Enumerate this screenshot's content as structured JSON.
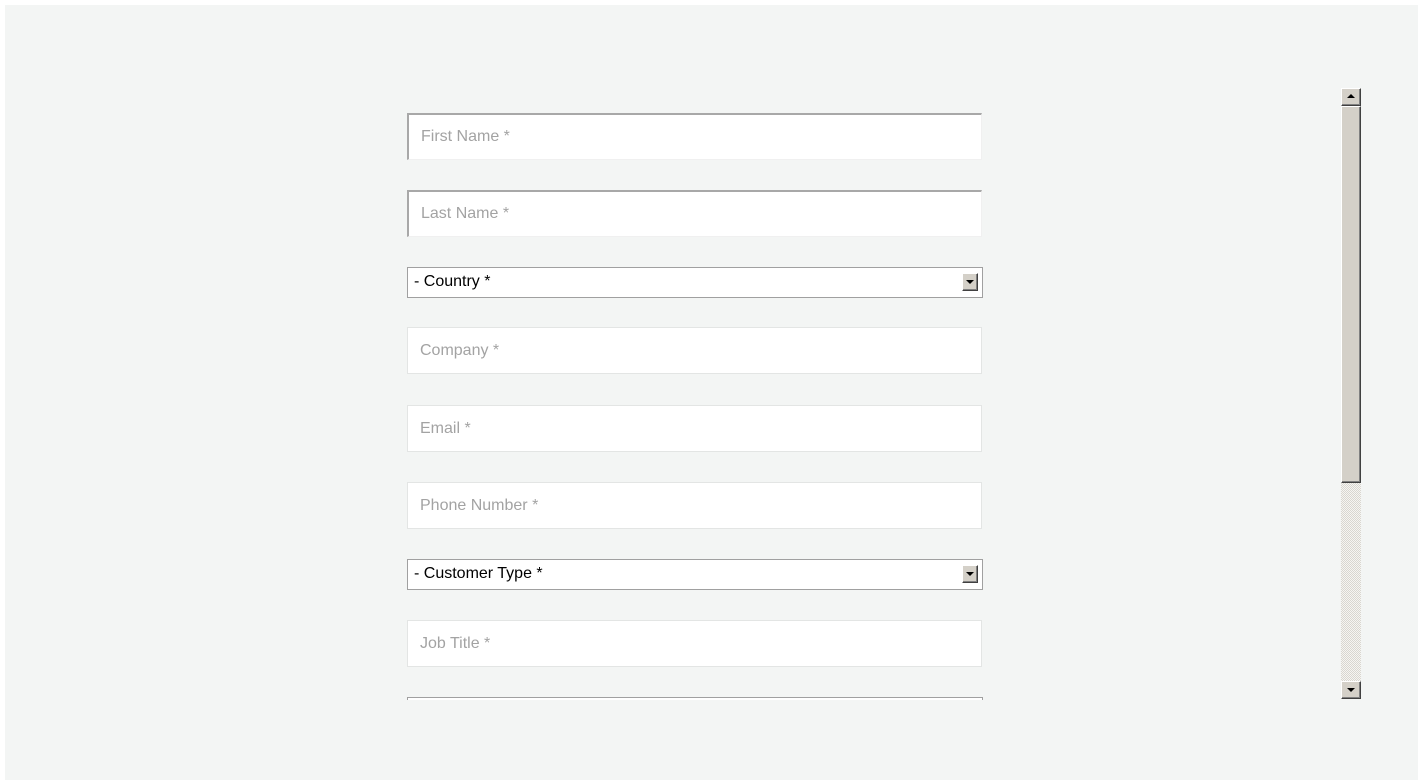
{
  "form": {
    "first_name": {
      "placeholder": "First Name *",
      "value": ""
    },
    "last_name": {
      "placeholder": "Last Name *",
      "value": ""
    },
    "country": {
      "selected": "- Country *"
    },
    "company": {
      "placeholder": "Company *",
      "value": ""
    },
    "email": {
      "placeholder": "Email *",
      "value": ""
    },
    "phone": {
      "placeholder": "Phone Number *",
      "value": ""
    },
    "customer_type": {
      "selected": "- Customer Type *"
    },
    "job_title": {
      "placeholder": "Job Title *",
      "value": ""
    },
    "next_select": {
      "selected": ""
    }
  },
  "icons": {
    "dropdown": "chevron-down-icon",
    "scroll_up": "scroll-up-arrow-icon",
    "scroll_down": "scroll-down-arrow-icon"
  },
  "colors": {
    "background": "#f3f5f4",
    "input_background": "#ffffff",
    "placeholder_text": "#a3a3a3",
    "control_face": "#d4d0c8"
  }
}
